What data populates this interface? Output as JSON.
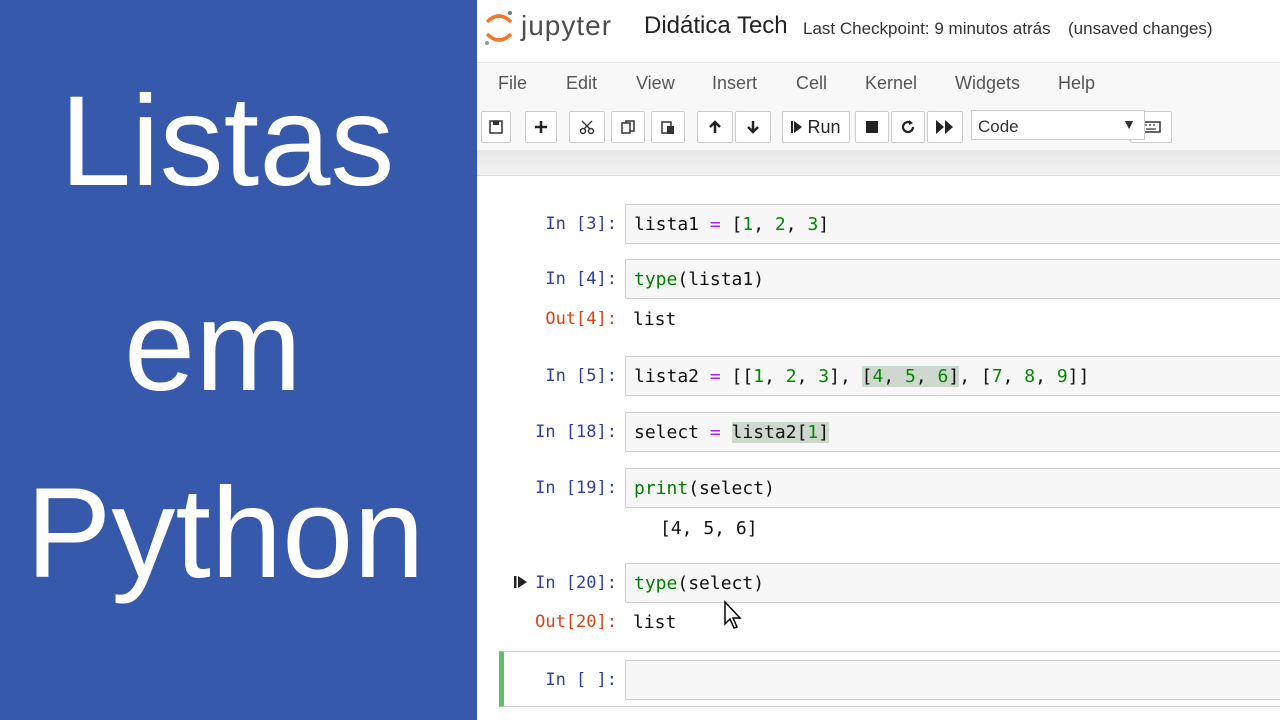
{
  "title_panel": {
    "line1": "Listas",
    "line2": "em",
    "line3": "Python",
    "background": "#3759ab"
  },
  "header": {
    "brand": "jupyter",
    "notebook_name": "Didática Tech",
    "checkpoint": "Last Checkpoint: 9 minutos atrás",
    "status": "(unsaved changes)"
  },
  "menu": [
    "File",
    "Edit",
    "View",
    "Insert",
    "Cell",
    "Kernel",
    "Widgets",
    "Help"
  ],
  "toolbar": {
    "run_label": "Run",
    "cell_type": "Code",
    "icons": [
      "save-icon",
      "plus-icon",
      "cut-icon",
      "copy-icon",
      "paste-icon",
      "arrow-up-icon",
      "arrow-down-icon",
      "run-icon",
      "stop-icon",
      "restart-icon",
      "fast-forward-icon",
      "keyboard-icon"
    ]
  },
  "cells": [
    {
      "prompt": "In [3]:",
      "code": "lista1 = [1, 2, 3]"
    },
    {
      "prompt": "In [4]:",
      "code": "type(lista1)",
      "out_prompt": "Out[4]:",
      "output": "list"
    },
    {
      "prompt": "In [5]:",
      "code": "lista2 = [[1, 2, 3], [4, 5, 6], [7, 8, 9]]"
    },
    {
      "prompt": "In [18]:",
      "code": "select = lista2[1]"
    },
    {
      "prompt": "In [19]:",
      "code": "print(select)",
      "output": "[4, 5, 6]"
    },
    {
      "prompt": "In [20]:",
      "code": "type(select)",
      "out_prompt": "Out[20]:",
      "output": "list"
    },
    {
      "prompt": "In [ ]:",
      "code": ""
    }
  ],
  "colors": {
    "prompt_in": "#303f9f",
    "prompt_out": "#d84315",
    "active_border": "#66bb6a"
  }
}
